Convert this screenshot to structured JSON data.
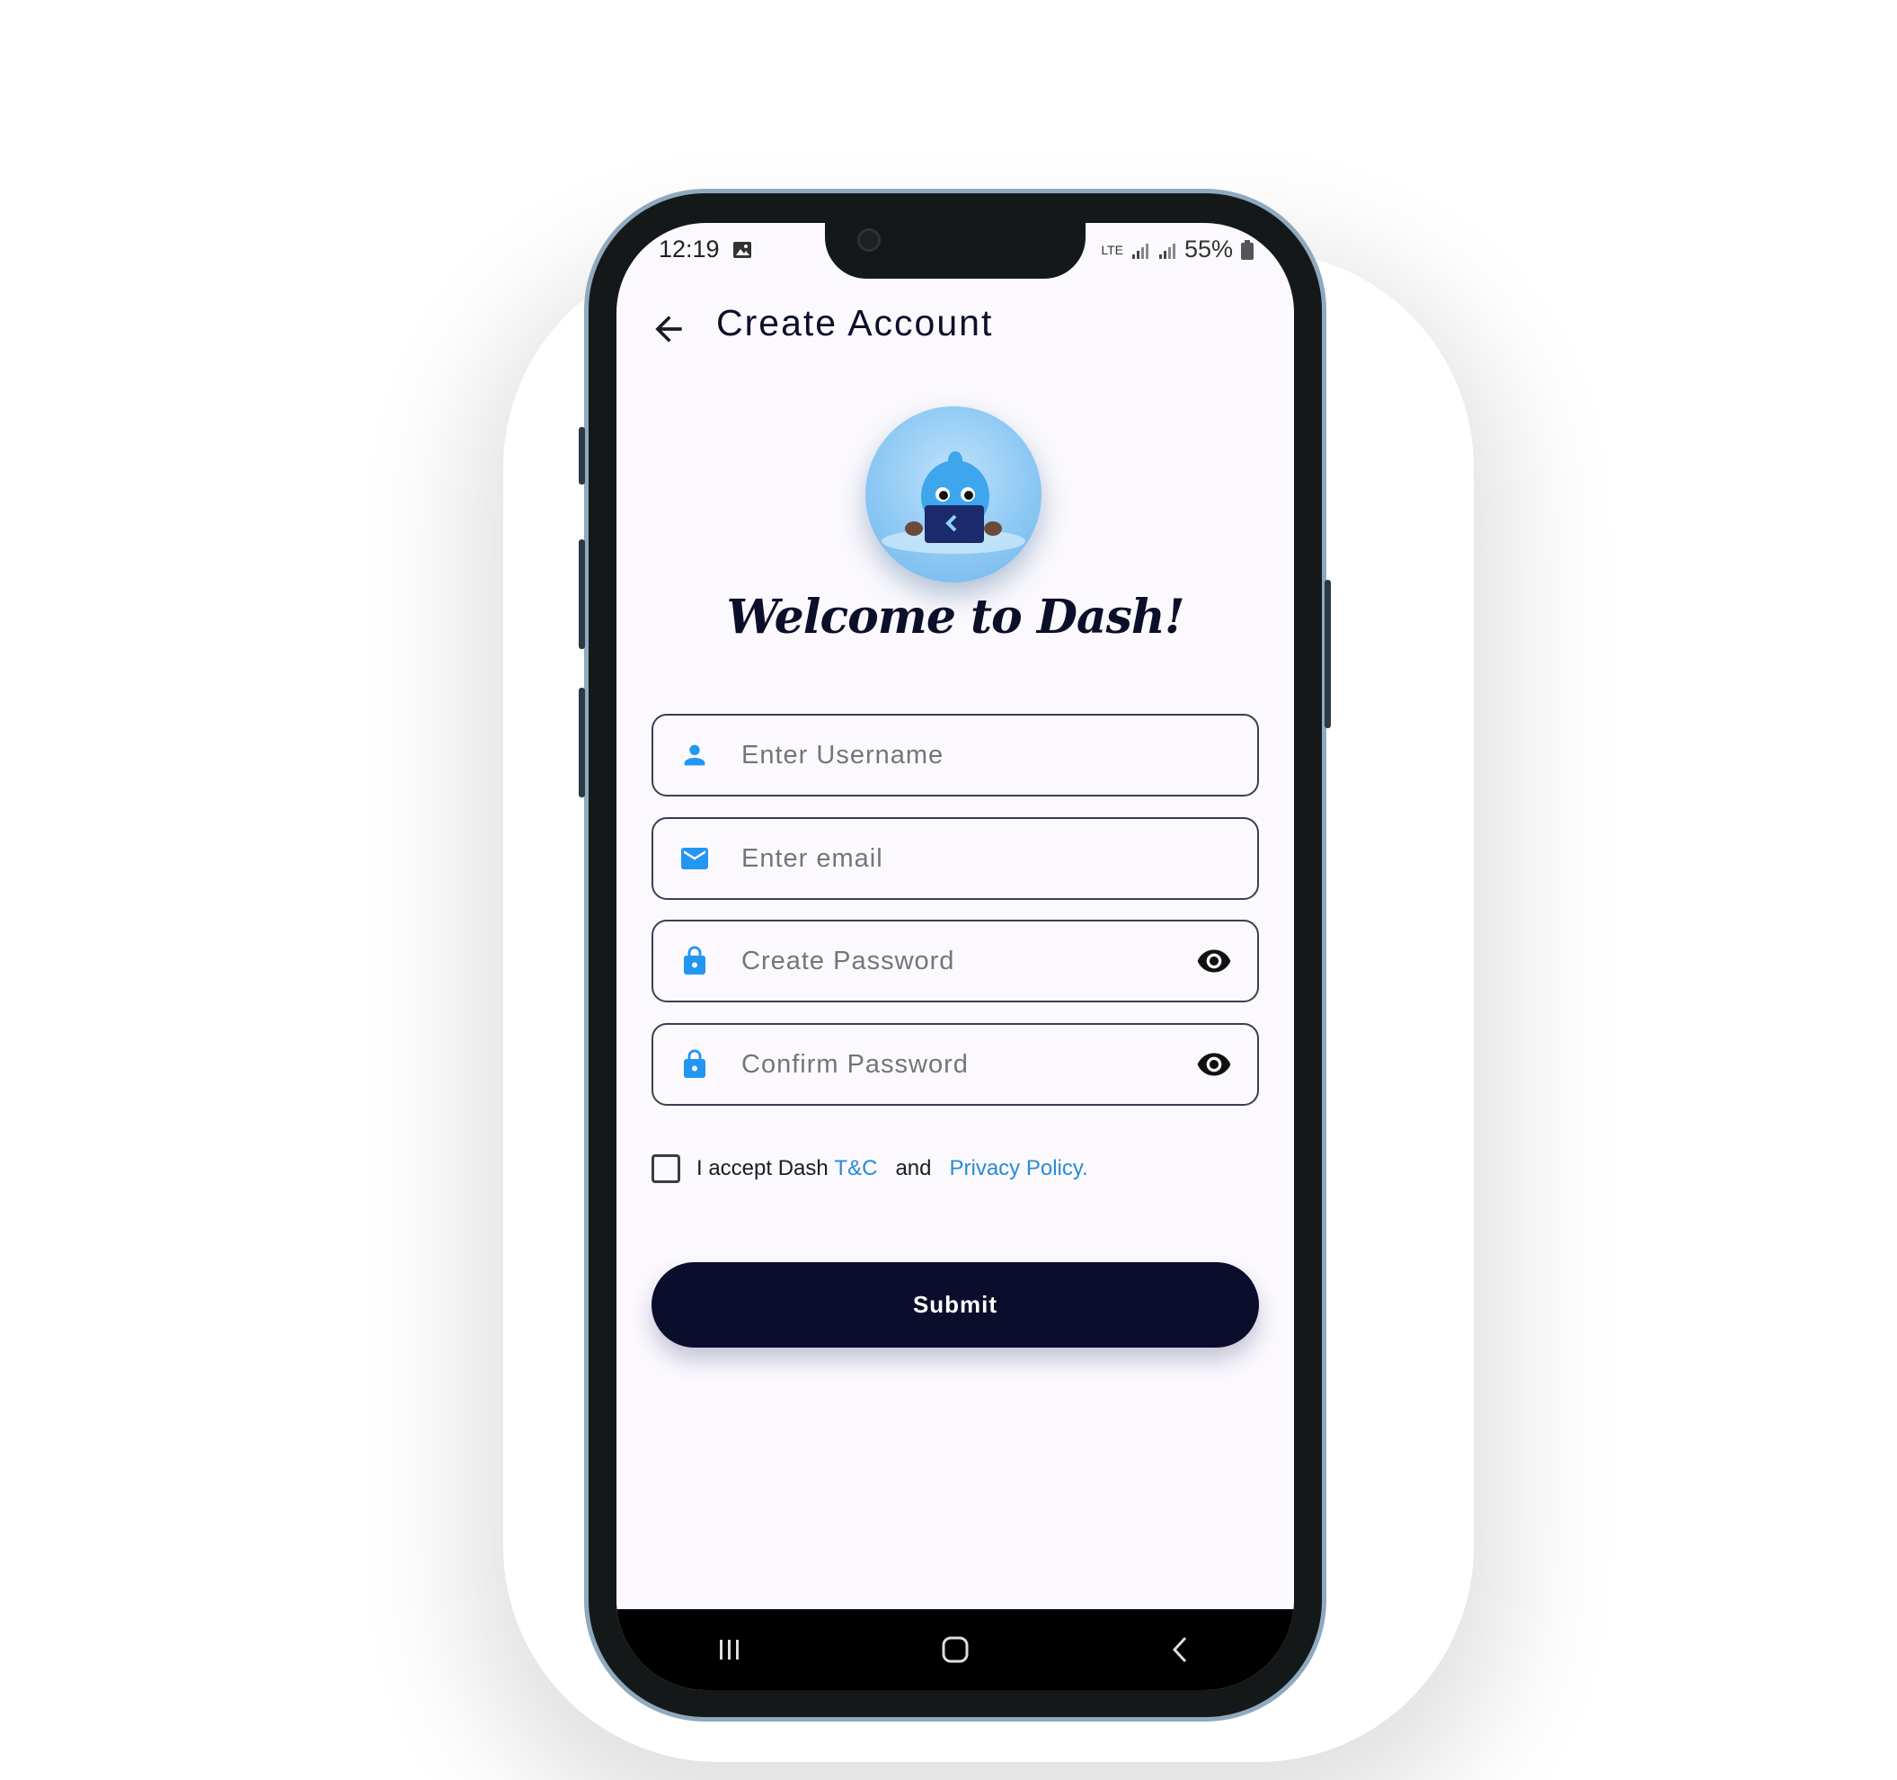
{
  "status_bar": {
    "time": "12:19",
    "network_label": "LTE",
    "battery": "55%"
  },
  "app_bar": {
    "title": "Create Account"
  },
  "welcome": {
    "heading": "Welcome to Dash!"
  },
  "form": {
    "username": {
      "placeholder": "Enter Username",
      "value": ""
    },
    "email": {
      "placeholder": "Enter email",
      "value": ""
    },
    "password": {
      "placeholder": "Create Password",
      "value": ""
    },
    "confirm_password": {
      "placeholder": "Confirm Password",
      "value": ""
    }
  },
  "terms": {
    "prefix": "I accept Dash",
    "tc_link": "T&C",
    "and": "and",
    "privacy_link": "Privacy Policy.",
    "checked": false
  },
  "submit_label": "Submit",
  "colors": {
    "accent": "#2196f3",
    "primary_dark": "#0b0d2d",
    "link": "#2b8ad8",
    "background": "#fbf9fd",
    "phone_frame": "#8fa9bf"
  },
  "icons": {
    "back": "arrow-left-icon",
    "username": "person-icon",
    "email": "mail-icon",
    "password": "lock-icon",
    "visibility": "eye-icon"
  }
}
